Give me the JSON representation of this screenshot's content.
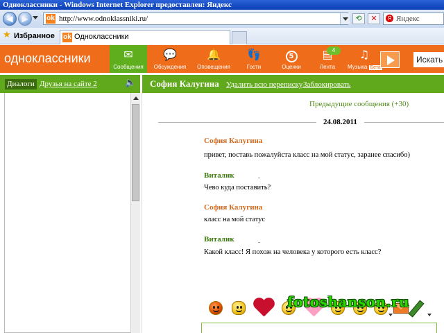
{
  "browser": {
    "title": "Одноклассники - Windows Internet Explorer предоставлен: Яндекс",
    "url": "http://www.odnoklassniki.ru/",
    "search_placeholder": "Яндекс",
    "favorites_label": "Избранное",
    "tab_title": "Одноклассники"
  },
  "site": {
    "logo": "одноклассники",
    "nav": [
      {
        "label": "Сообщения",
        "icon": "envelope-icon",
        "active": true
      },
      {
        "label": "Обсуждения",
        "icon": "speech-bubbles-icon"
      },
      {
        "label": "Оповещения",
        "icon": "bell-icon"
      },
      {
        "label": "Гости",
        "icon": "footprints-icon"
      },
      {
        "label": "Оценки",
        "icon": "rating-icon",
        "count": "5"
      },
      {
        "label": "Лента",
        "icon": "feed-icon",
        "badge": "4"
      },
      {
        "label": "Музыка",
        "icon": "music-note-icon",
        "badge_text": "Бета"
      }
    ],
    "search_value": "Искать н"
  },
  "dialogs": {
    "tab_active": "Диалоги",
    "tab_friends": "Друзья на сайте 2"
  },
  "conversation": {
    "contact": "София Калугина",
    "delete_link": "Удалить всю переписку",
    "block_link": "Заблокировать",
    "previous": "Предыдущие сообщения (+30)",
    "date": "24.08.2011",
    "messages": [
      {
        "author": "София Калугина",
        "text": "привет, поставь пожалуйста класс на мой статус, заранее спасибо)"
      },
      {
        "author": "Виталик",
        "text": "Чево куда поставить?"
      },
      {
        "author": "София Калугина",
        "text": "класс на мой статус"
      },
      {
        "author": "Виталик",
        "text": "Какой класс! Я похож на человека у которого есть класс?"
      }
    ]
  },
  "watermark": "fotoshanson.ru",
  "colors": {
    "site_orange": "#ef6c1a",
    "site_green": "#61a91c",
    "author_orange": "#d2691e",
    "author_green": "#3f7d10"
  }
}
